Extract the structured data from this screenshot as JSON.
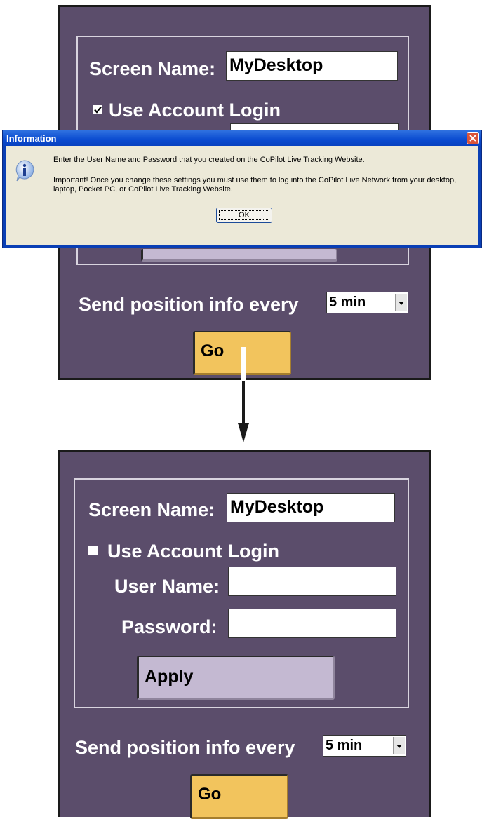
{
  "top_panel": {
    "screen_name_label": "Screen Name:",
    "screen_name_value": "MyDesktop",
    "use_account_login_label": "Use Account Login",
    "use_account_login_checked": true,
    "send_position_label": "Send position info every",
    "interval_value": "5 min",
    "go_label": "Go"
  },
  "dialog": {
    "title": "Information",
    "message_line1": "Enter the User Name and Password that you created on the CoPilot Live Tracking Website.",
    "message_line2": "Important!  Once you change these settings you must use them to log into the CoPilot Live Network from your desktop,",
    "message_line3": "laptop, Pocket PC, or CoPilot Live Tracking Website.",
    "ok_label": "OK"
  },
  "bottom_panel": {
    "screen_name_label": "Screen Name:",
    "screen_name_value": "MyDesktop",
    "use_account_login_label": "Use Account Login",
    "use_account_login_checked": false,
    "user_name_label": "User Name:",
    "user_name_value": "",
    "password_label": "Password:",
    "password_value": "",
    "apply_label": "Apply",
    "send_position_label": "Send position info every",
    "interval_value": "5 min",
    "go_label": "Go"
  },
  "colors": {
    "panel_bg": "#5b4d6b",
    "go_button": "#f2c45d",
    "apply_button": "#c4b9d2",
    "dialog_title": "#0a4bd0"
  },
  "icons": [
    "checkbox-checked-icon",
    "checkbox-unchecked-icon",
    "info-icon",
    "close-icon",
    "dropdown-arrow-icon",
    "down-arrow-icon"
  ]
}
